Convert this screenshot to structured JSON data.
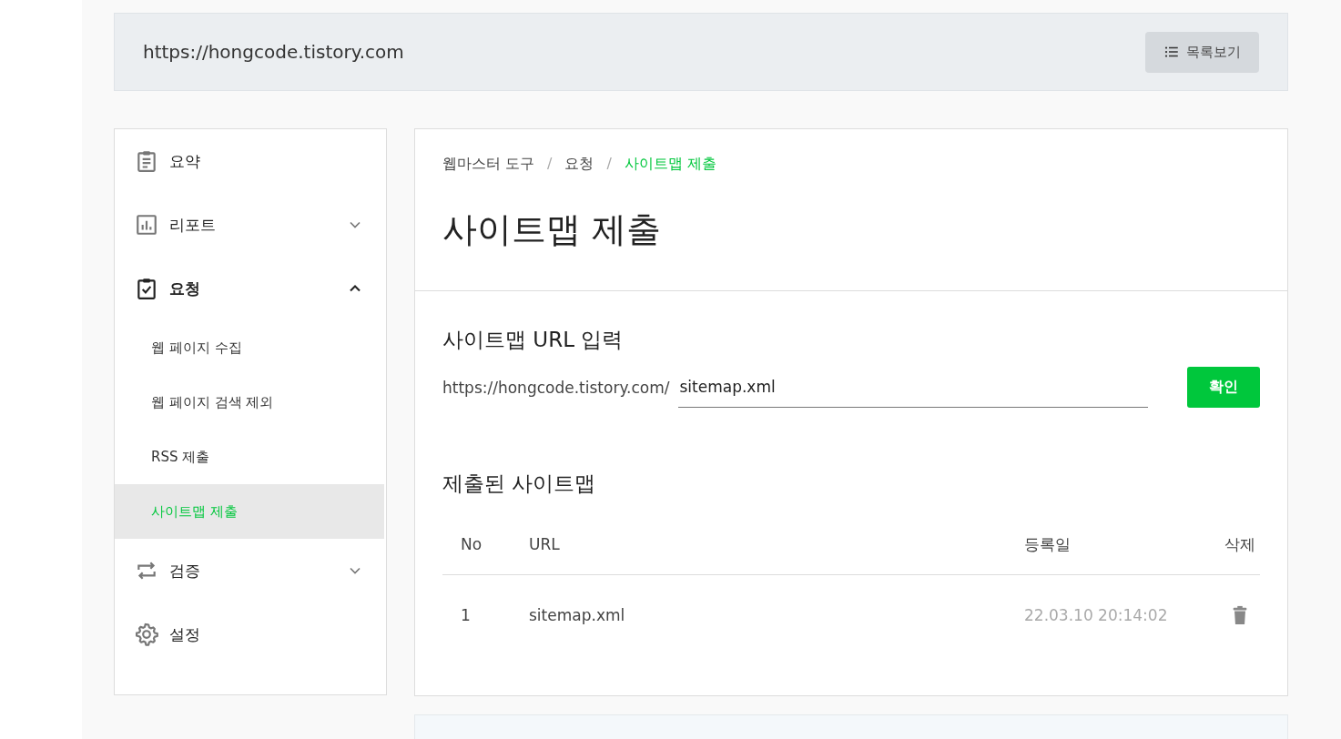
{
  "header": {
    "url": "https://hongcode.tistory.com",
    "list_button": "목록보기"
  },
  "sidebar": {
    "items": [
      {
        "label": "요약",
        "kind": "clipboard"
      },
      {
        "label": "리포트",
        "kind": "chart",
        "expanded": false
      },
      {
        "label": "요청",
        "kind": "check-clipboard",
        "expanded": true,
        "children": [
          {
            "label": "웹 페이지 수집",
            "selected": false
          },
          {
            "label": "웹 페이지 검색 제외",
            "selected": false
          },
          {
            "label": "RSS 제출",
            "selected": false
          },
          {
            "label": "사이트맵 제출",
            "selected": true
          }
        ]
      },
      {
        "label": "검증",
        "kind": "arrows",
        "expanded": false
      },
      {
        "label": "설정",
        "kind": "gear"
      }
    ]
  },
  "breadcrumb": [
    "웹마스터 도구",
    "요청",
    "사이트맵 제출"
  ],
  "breadcrumb_separator": "/",
  "page_title": "사이트맵 제출",
  "url_section": {
    "title": "사이트맵 URL 입력",
    "prefix": "https://hongcode.tistory.com/",
    "value": "sitemap.xml",
    "button": "확인"
  },
  "submitted": {
    "title": "제출된 사이트맵",
    "columns": [
      "No",
      "URL",
      "등록일",
      "삭제"
    ],
    "rows": [
      {
        "no": "1",
        "url": "sitemap.xml",
        "date": "22.03.10 20:14:02"
      }
    ]
  }
}
